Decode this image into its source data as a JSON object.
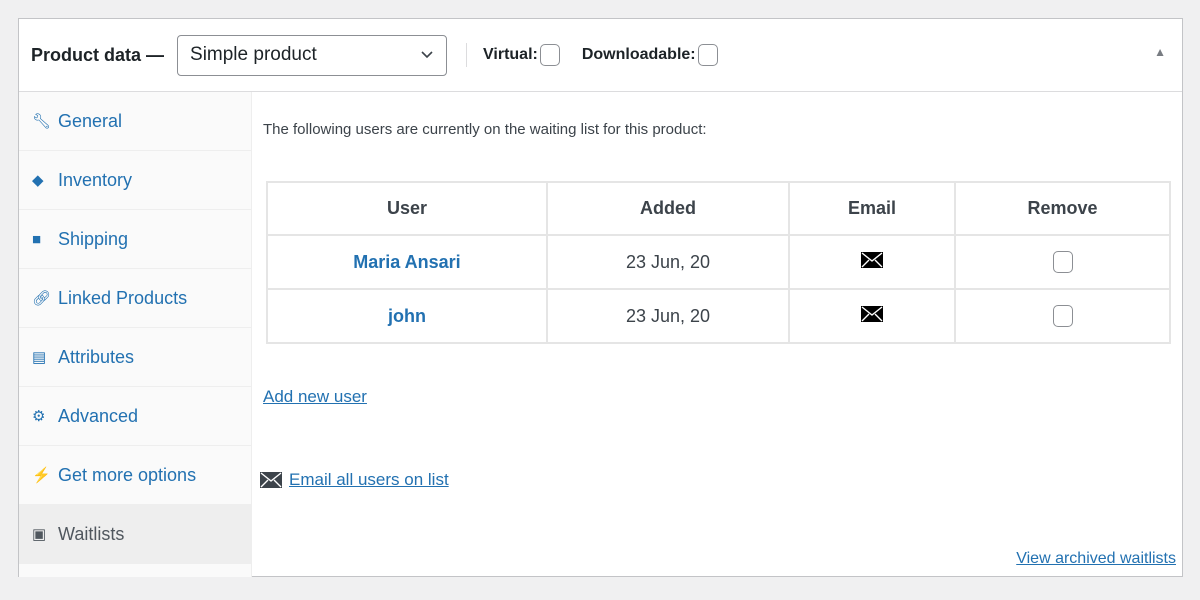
{
  "header": {
    "title": "Product data —",
    "product_type": "Simple product",
    "virtual_label": "Virtual:",
    "downloadable_label": "Downloadable:",
    "virtual_checked": false,
    "downloadable_checked": false
  },
  "sidebar": {
    "items": [
      {
        "label": "General",
        "icon": "wrench-icon"
      },
      {
        "label": "Inventory",
        "icon": "tag-icon"
      },
      {
        "label": "Shipping",
        "icon": "truck-icon"
      },
      {
        "label": "Linked Products",
        "icon": "link-icon"
      },
      {
        "label": "Attributes",
        "icon": "list-icon"
      },
      {
        "label": "Advanced",
        "icon": "gear-icon"
      },
      {
        "label": "Get more options",
        "icon": "plug-icon"
      },
      {
        "label": "Waitlists",
        "icon": "waitlist-bag-icon",
        "active": true
      }
    ]
  },
  "main": {
    "intro": "The following users are currently on the waiting list for this product:",
    "table": {
      "headers": [
        "User",
        "Added",
        "Email",
        "Remove"
      ],
      "rows": [
        {
          "user": "Maria Ansari",
          "added": "23 Jun, 20"
        },
        {
          "user": "john",
          "added": "23 Jun, 20"
        }
      ]
    },
    "add_user": "Add new user",
    "email_all": "Email all users on list",
    "view_archived": "View archived waitlists"
  },
  "colors": {
    "link": "#2271b1",
    "active_bg": "#eeeeee"
  }
}
